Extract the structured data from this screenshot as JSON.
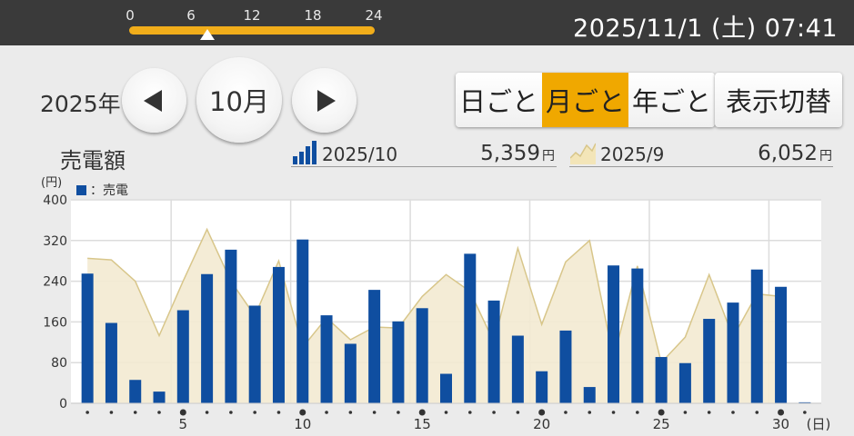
{
  "header": {
    "timeline_ticks": [
      "0",
      "6",
      "12",
      "18",
      "24"
    ],
    "timeline_current_hour": 7.68,
    "datetime": "2025/11/1 (土) 07:41"
  },
  "nav": {
    "year_label": "2025年",
    "month_label": "10月"
  },
  "view_tabs": {
    "day": "日ごと",
    "month": "月ごと",
    "year": "年ごと",
    "active": "month"
  },
  "toggle_label": "表示切替",
  "metric_title": "売電額",
  "summary": {
    "current_period": "2025/10",
    "current_value": "5,359",
    "previous_period": "2025/9",
    "previous_value": "6,052",
    "unit": "円"
  },
  "colors": {
    "bar": "#0f4ea0",
    "area_fill": "#f3ead2",
    "area_line": "#d8c68a",
    "accent": "#f0a800"
  },
  "chart_data": {
    "type": "bar",
    "ylabel": "(円)",
    "xlabel": "(日)",
    "ylim": [
      0,
      400
    ],
    "yticks": [
      0,
      80,
      160,
      240,
      320,
      400
    ],
    "x_tick_labels": [
      {
        "day": 5,
        "label": "5"
      },
      {
        "day": 10,
        "label": "10"
      },
      {
        "day": 15,
        "label": "15"
      },
      {
        "day": 20,
        "label": "20"
      },
      {
        "day": 25,
        "label": "25"
      },
      {
        "day": 30,
        "label": "30"
      }
    ],
    "legend": [
      {
        "name": "：売電"
      }
    ],
    "days": [
      1,
      2,
      3,
      4,
      5,
      6,
      7,
      8,
      9,
      10,
      11,
      12,
      13,
      14,
      15,
      16,
      17,
      18,
      19,
      20,
      21,
      22,
      23,
      24,
      25,
      26,
      27,
      28,
      29,
      30,
      31
    ],
    "series": [
      {
        "name": "2025/10",
        "kind": "bar",
        "values": [
          255,
          158,
          46,
          23,
          183,
          254,
          302,
          192,
          268,
          322,
          173,
          117,
          223,
          161,
          187,
          58,
          294,
          202,
          133,
          63,
          143,
          32,
          271,
          265,
          91,
          79,
          166,
          198,
          263,
          229,
          2
        ]
      },
      {
        "name": "2025/9",
        "kind": "area",
        "values": [
          285,
          282,
          240,
          133,
          240,
          342,
          240,
          172,
          280,
          110,
          168,
          125,
          150,
          148,
          210,
          253,
          220,
          120,
          305,
          155,
          278,
          320,
          88,
          270,
          80,
          130,
          253,
          130,
          215,
          210
        ]
      }
    ],
    "grid": true
  }
}
